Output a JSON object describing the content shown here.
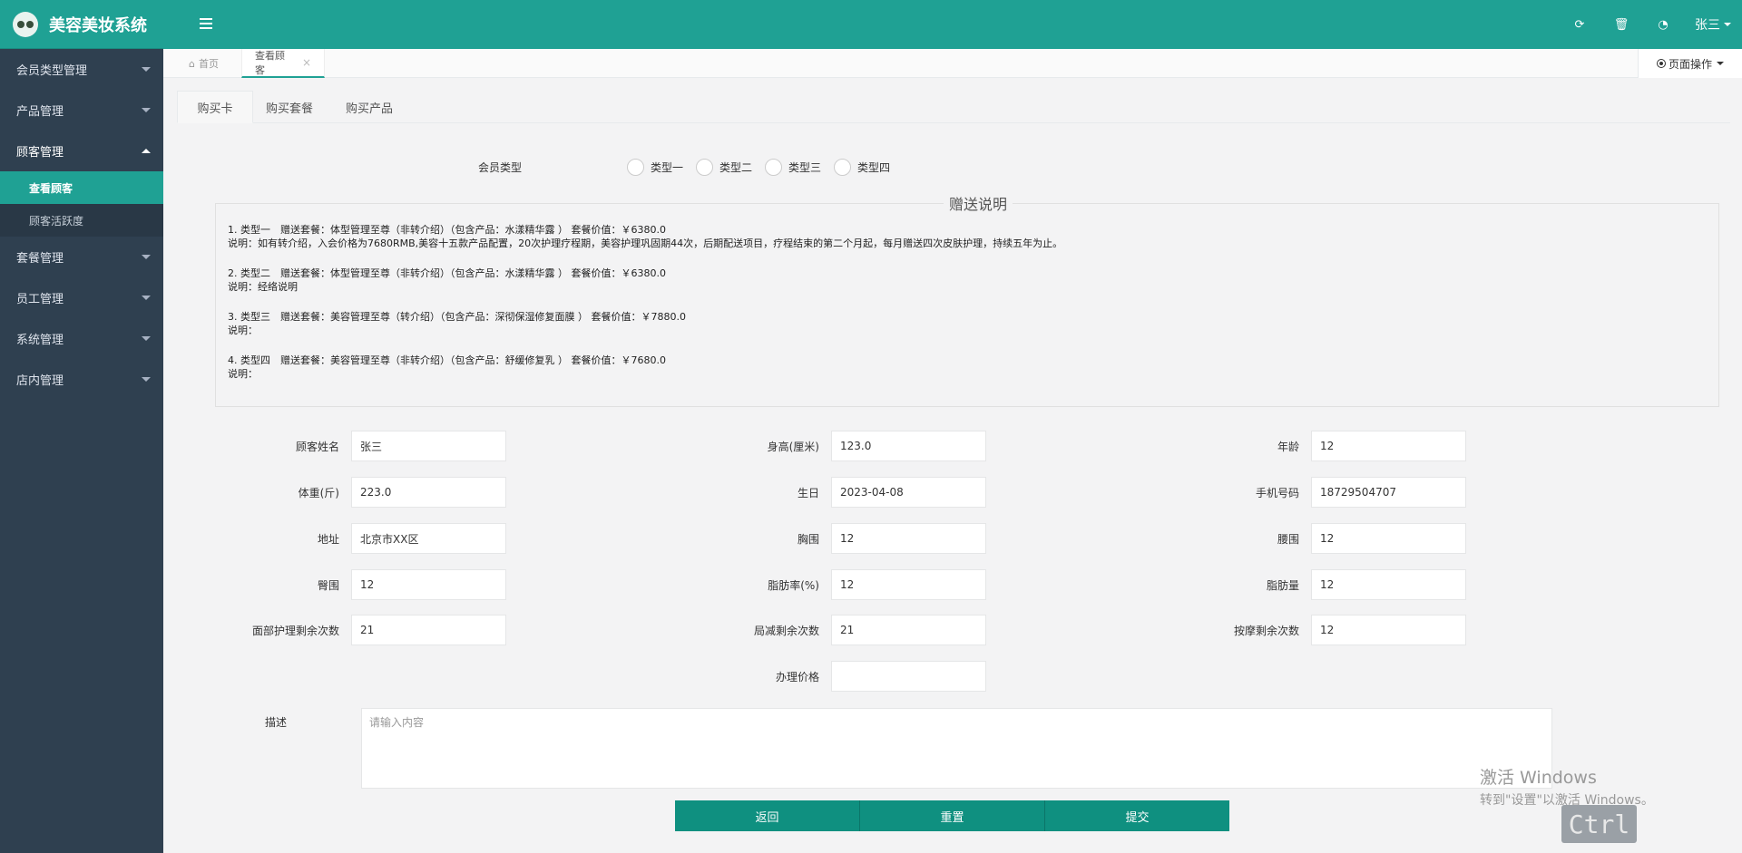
{
  "app": {
    "title": "美容美妆系统"
  },
  "sidebar": {
    "items": [
      {
        "label": "会员类型管理",
        "open": false
      },
      {
        "label": "产品管理",
        "open": false
      },
      {
        "label": "顾客管理",
        "open": true,
        "children": [
          {
            "label": "查看顾客",
            "active": true
          },
          {
            "label": "顾客活跃度",
            "active": false
          }
        ]
      },
      {
        "label": "套餐管理",
        "open": false
      },
      {
        "label": "员工管理",
        "open": false
      },
      {
        "label": "系统管理",
        "open": false
      },
      {
        "label": "店内管理",
        "open": false
      }
    ]
  },
  "header": {
    "icons": [
      "refresh-icon",
      "trash-icon",
      "dashboard-icon"
    ],
    "user": "张三"
  },
  "page_tabs": {
    "home": "首页",
    "active": "查看顾客",
    "page_ops": "页面操作"
  },
  "content_tabs": [
    "购买卡",
    "购买套餐",
    "购买产品"
  ],
  "member_type": {
    "label": "会员类型",
    "options": [
      "类型一",
      "类型二",
      "类型三",
      "类型四"
    ]
  },
  "gift": {
    "title": "赠送说明",
    "blocks": [
      {
        "line1": "1. 类型一　赠送套餐：体型管理至尊（非转介绍）（包含产品：水漾精华露 ）  套餐价值：￥6380.0",
        "line2": "说明：如有转介绍，入会价格为7680RMB,美容十五款产品配置，20次护理疗程期，美容护理巩固期44次，后期配送项目，疗程结束的第二个月起，每月赠送四次皮肤护理，持续五年为止。"
      },
      {
        "line1": "2. 类型二　赠送套餐：体型管理至尊（非转介绍）（包含产品：水漾精华露 ）  套餐价值：￥6380.0",
        "line2": "说明：经络说明"
      },
      {
        "line1": "3. 类型三　赠送套餐：美容管理至尊（转介绍）（包含产品：深彻保湿修复面膜 ）  套餐价值：￥7880.0",
        "line2": "说明："
      },
      {
        "line1": "4. 类型四　赠送套餐：美容管理至尊（非转介绍）（包含产品：舒缓修复乳 ）  套餐价值：￥7680.0",
        "line2": "说明："
      }
    ]
  },
  "form": {
    "name": {
      "label": "顾客姓名",
      "value": "张三"
    },
    "height": {
      "label": "身高(厘米)",
      "value": "123.0"
    },
    "age": {
      "label": "年龄",
      "value": "12"
    },
    "weight": {
      "label": "体重(斤)",
      "value": "223.0"
    },
    "birthday": {
      "label": "生日",
      "value": "2023-04-08"
    },
    "phone": {
      "label": "手机号码",
      "value": "18729504707"
    },
    "address": {
      "label": "地址",
      "value": "北京市XX区"
    },
    "chest": {
      "label": "胸围",
      "value": "12"
    },
    "waist": {
      "label": "腰围",
      "value": "12"
    },
    "hip": {
      "label": "臀围",
      "value": "12"
    },
    "fat_rate": {
      "label": "脂肪率(%)",
      "value": "12"
    },
    "fat_amount": {
      "label": "脂肪量",
      "value": "12"
    },
    "facial_left": {
      "label": "面部护理剩余次数",
      "value": "21"
    },
    "local_left": {
      "label": "局减剩余次数",
      "value": "21"
    },
    "massage_left": {
      "label": "按摩剩余次数",
      "value": "12"
    },
    "price": {
      "label": "办理价格",
      "value": ""
    },
    "desc": {
      "label": "描述",
      "placeholder": "请输入内容"
    }
  },
  "buttons": {
    "back": "返回",
    "reset": "重置",
    "submit": "提交"
  },
  "watermark": {
    "line1": "激活 Windows",
    "line2": "转到\"设置\"以激活 Windows。"
  },
  "ctrl_badge": "Ctrl",
  "colors": {
    "accent": "#1fa194",
    "sidebar": "#2f4050",
    "button": "#0f9080"
  }
}
